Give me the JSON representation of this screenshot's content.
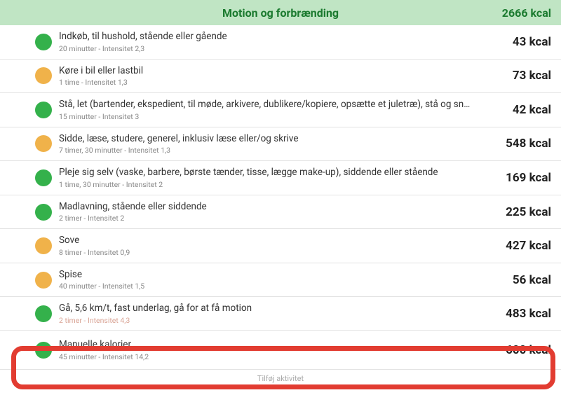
{
  "header": {
    "title": "Motion og forbrænding",
    "total": "2666 kcal"
  },
  "rows": [
    {
      "color": "green",
      "title": "Indkøb, til hushold, stående eller gående",
      "sub": "20 minutter - Intensitet 2,3",
      "value": "43 kcal"
    },
    {
      "color": "orange",
      "title": "Køre i bil eller lastbil",
      "sub": "1 time - Intensitet 1,3",
      "value": "73 kcal"
    },
    {
      "color": "green",
      "title": "Stå, let (bartender, ekspedient, til møde, arkivere, dublikere/kopiere, opsætte et juletræ), stå og sn…",
      "sub": "15 minutter - Intensitet 3",
      "value": "42 kcal"
    },
    {
      "color": "orange",
      "title": "Sidde, læse, studere, generel, inklusiv læse eller/og skrive",
      "sub": "7 timer, 30 minutter - Intensitet 1,3",
      "value": "548 kcal"
    },
    {
      "color": "green",
      "title": "Pleje sig selv (vaske, barbere, børste tænder, tisse, lægge make-up), siddende eller stående",
      "sub": "1 time, 30 minutter - Intensitet 2",
      "value": "169 kcal"
    },
    {
      "color": "green",
      "title": "Madlavning, stående eller siddende",
      "sub": "2 timer - Intensitet 2",
      "value": "225 kcal"
    },
    {
      "color": "orange",
      "title": "Sove",
      "sub": "8 timer - Intensitet 0,9",
      "value": "427 kcal"
    },
    {
      "color": "orange",
      "title": "Spise",
      "sub": "40 minutter - Intensitet 1,5",
      "value": "56 kcal"
    },
    {
      "color": "green",
      "title": "Gå, 5,6 km/t, fast underlag, gå for at få motion",
      "sub": "2 timer - Intensitet 4,3",
      "value": "483 kcal"
    },
    {
      "color": "green",
      "title": "Manuelle kalorier",
      "sub": "45 minutter - Intensitet 14,2",
      "value": "600 kcal"
    }
  ],
  "footer": {
    "add_label": "Tilføj aktivitet"
  }
}
